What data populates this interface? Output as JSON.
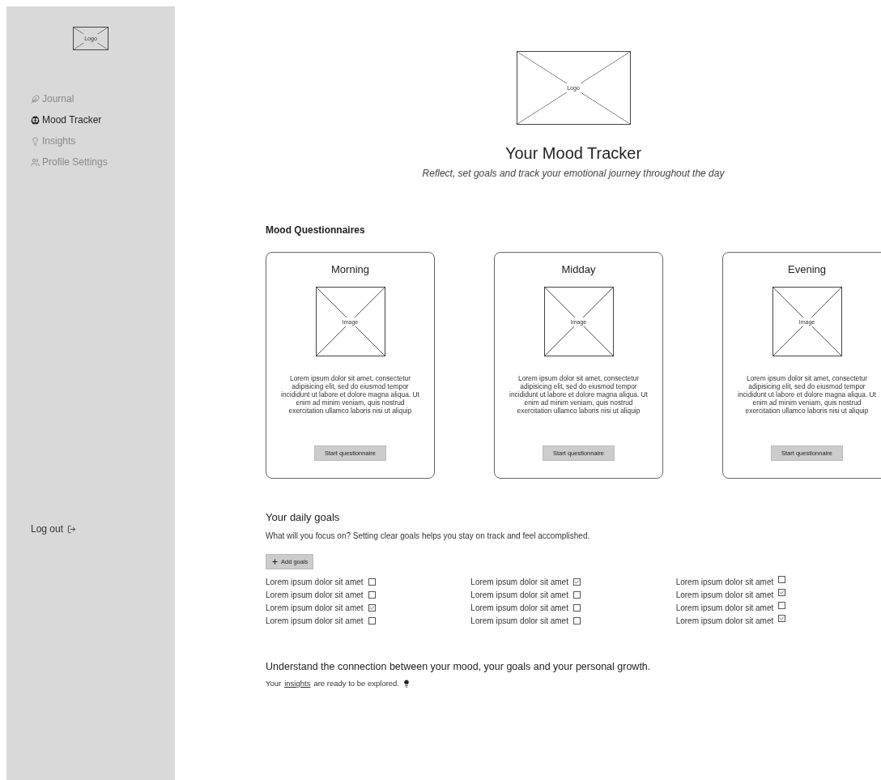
{
  "sidebar": {
    "logo": "Logo",
    "items": [
      {
        "label": "Journal",
        "selected": false
      },
      {
        "label": "Mood Tracker",
        "selected": true
      },
      {
        "label": "Insights",
        "selected": false
      },
      {
        "label": "Profile Settings",
        "selected": false
      }
    ],
    "logout": "Log out"
  },
  "header": {
    "logo": "Logo",
    "title": "Your Mood Tracker",
    "subtitle": "Reflect, set goals and track your emotional journey throughout the day"
  },
  "questionnaires": {
    "heading": "Mood Questionnaires",
    "cards": [
      {
        "title": "Morning",
        "image": "Image",
        "text": "Lorem ipsum dolor sit amet, consectetur adipisicing elit, sed do eiusmod tempor incididunt ut labore et dolore magna aliqua. Ut enim ad minim veniam, quis nostrud exercitation ullamco laboris nisi ut aliquip",
        "button": "Start questionnaire"
      },
      {
        "title": "Midday",
        "image": "Image",
        "text": "Lorem ipsum dolor sit amet, consectetur adipisicing elit, sed do eiusmod tempor incididunt ut labore et dolore magna aliqua. Ut enim ad minim veniam, quis nostrud exercitation ullamco laboris nisi ut aliquip",
        "button": "Start questionnaire"
      },
      {
        "title": "Evening",
        "image": "Image",
        "text": "Lorem ipsum dolor sit amet, consectetur adipisicing elit, sed do eiusmod tempor incididunt ut labore et dolore magna aliqua. Ut enim ad minim veniam, quis nostrud exercitation ullamco laboris nisi ut aliquip",
        "button": "Start questionnaire"
      }
    ]
  },
  "goals": {
    "heading": "Your daily goals",
    "intro": "What will you focus on? Setting clear goals helps you stay on track and feel accomplished.",
    "add_button": "Add goals",
    "columns": [
      [
        {
          "label": "Lorem ipsum dolor sit amet",
          "checked": false
        },
        {
          "label": "Lorem ipsum dolor sit amet",
          "checked": false
        },
        {
          "label": "Lorem ipsum dolor sit amet",
          "checked": true
        },
        {
          "label": "Lorem ipsum dolor sit amet",
          "checked": false
        }
      ],
      [
        {
          "label": "Lorem ipsum dolor sit amet",
          "checked": true
        },
        {
          "label": "Lorem ipsum dolor sit amet",
          "checked": false
        },
        {
          "label": "Lorem ipsum dolor sit amet",
          "checked": false
        },
        {
          "label": "Lorem ipsum dolor sit amet",
          "checked": false
        }
      ],
      [
        {
          "label": "Lorem ipsum dolor sit amet",
          "checked": false
        },
        {
          "label": "Lorem ipsum dolor sit amet",
          "checked": true
        },
        {
          "label": "Lorem ipsum dolor sit amet",
          "checked": false
        },
        {
          "label": "Lorem ipsum dolor sit amet",
          "checked": true
        }
      ]
    ]
  },
  "insights": {
    "heading": "Understand the connection between your mood, your goals and your personal growth.",
    "before": "Your",
    "link": "insights",
    "after": "are ready to be explored."
  }
}
